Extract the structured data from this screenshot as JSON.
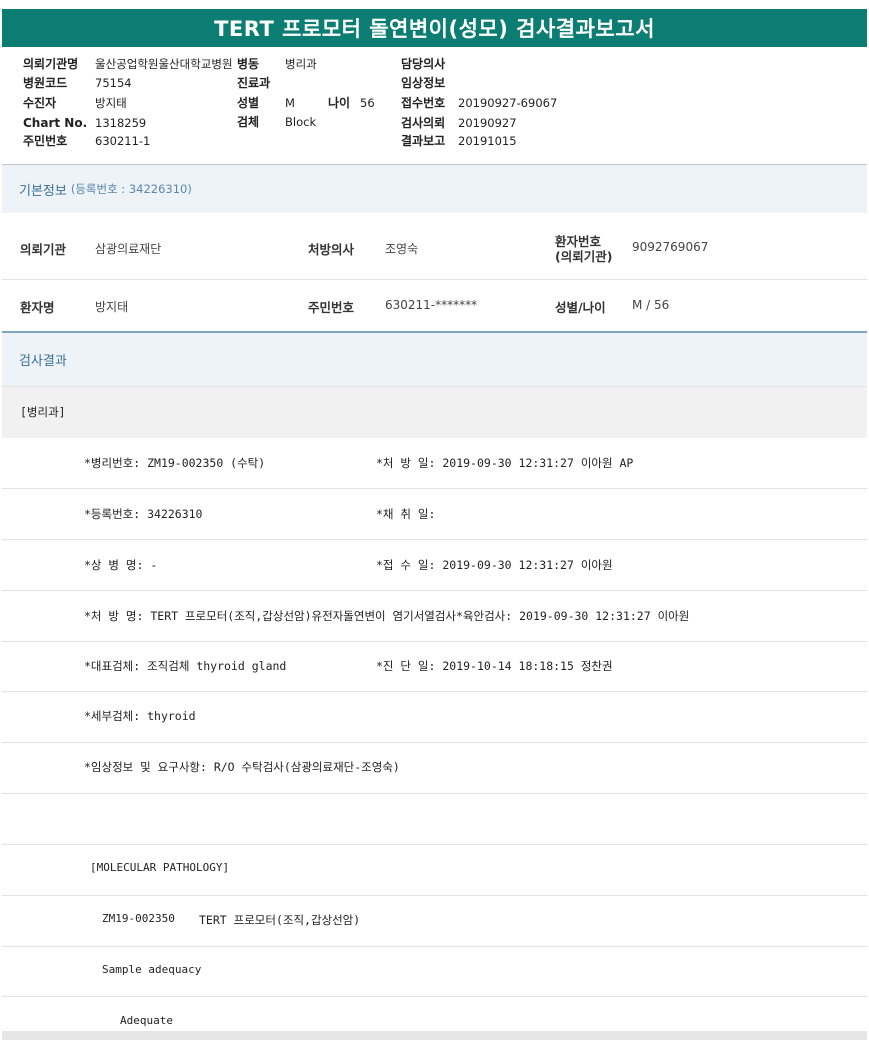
{
  "title": "TERT 프로모터 돌연변이(성모) 검사결과보고서",
  "header": {
    "col1": [
      {
        "label": "의뢰기관명",
        "value": "울산공업학원울산대학교병원"
      },
      {
        "label": "병원코드",
        "value": "75154"
      },
      {
        "label": "수진자",
        "value": "방지태"
      },
      {
        "label": "Chart No.",
        "value": "1318259"
      },
      {
        "label": "주민번호",
        "value": "630211-1"
      }
    ],
    "col2": [
      {
        "label": "병동",
        "value": "병리과"
      },
      {
        "label": "진료과",
        "value": ""
      },
      {
        "label": "성별",
        "value": "M"
      },
      {
        "label": "검체",
        "value": "Block"
      }
    ],
    "age": {
      "label": "나이",
      "value": "56"
    },
    "col3": [
      {
        "label": "담당의사",
        "value": ""
      },
      {
        "label": "임상정보",
        "value": ""
      },
      {
        "label": "접수번호",
        "value": "20190927-69067"
      },
      {
        "label": "검사의뢰",
        "value": "20190927"
      },
      {
        "label": "결과보고",
        "value": "20191015"
      }
    ]
  },
  "basic_info": {
    "heading": "기본정보",
    "reg_no": "(등록번호 : 34226310)",
    "rows": [
      [
        {
          "label": "의뢰기관",
          "value": "삼광의료재단"
        },
        {
          "label": "처방의사",
          "value": "조영숙"
        },
        {
          "label": "환자번호",
          "label2": "(의뢰기관)",
          "value": "9092769067"
        }
      ],
      [
        {
          "label": "환자명",
          "value": "방지태"
        },
        {
          "label": "주민번호",
          "value": "630211-*******"
        },
        {
          "label": "성별/나이",
          "value": "M / 56"
        }
      ]
    ]
  },
  "results": {
    "heading": "검사결과",
    "dept": "[병리과]",
    "rows": [
      {
        "left": "*병리번호: ZM19-002350 (수탁)",
        "right": "*처 방 일: 2019-09-30 12:31:27  이아원 AP"
      },
      {
        "left": "*등록번호: 34226310",
        "right": "*채 취 일:"
      },
      {
        "left": "*상 병 명: -",
        "right": "*접 수 일: 2019-09-30 12:31:27  이아원"
      },
      {
        "left": "*처 방 명: TERT 프로모터(조직,갑상선암)유전자돌연변이 염기서열검사*육안검사: 2019-09-30 12:31:27  이아원",
        "right": ""
      },
      {
        "left": "*대표검체: 조직검체 thyroid gland",
        "right": "*진 단 일: 2019-10-14 18:18:15  정찬권"
      },
      {
        "left": "*세부검체: thyroid",
        "right": ""
      },
      {
        "left": "*임상정보 및 요구사항: R/O 수탁검사(삼광의료재단-조영숙)",
        "right": ""
      },
      {
        "left": "",
        "right": ""
      }
    ],
    "mp_heading": "[MOLECULAR PATHOLOGY]",
    "mp_line_id": "ZM19-002350",
    "mp_line_text": "TERT 프로모터(조직,갑상선암)",
    "sample_adequacy": "Sample adequacy",
    "adequate": "Adequate"
  }
}
